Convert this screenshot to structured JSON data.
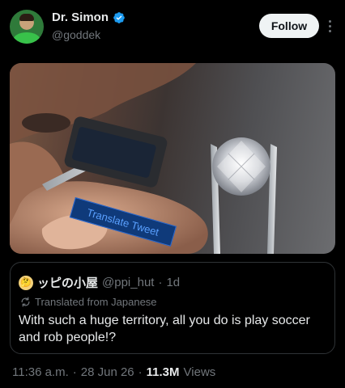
{
  "author": {
    "display_name": "Dr. Simon",
    "handle": "@goddek",
    "verified": true,
    "follow_label": "Follow"
  },
  "media": {
    "overlay_label": "Translate Tweet"
  },
  "quote": {
    "avatar_glyph": "🤔",
    "display_name": "ッピの小屋",
    "handle": "@ppi_hut",
    "separator": "·",
    "time": "1d",
    "translated_label": "Translated from Japanese",
    "text": "With such a huge territory, all you do is play soccer and rob people!?"
  },
  "meta": {
    "time": "11:36 a.m.",
    "sep1": "·",
    "date": "28 Jun 26",
    "sep2": "·",
    "views_count": "11.3M",
    "views_label": "Views"
  },
  "colors": {
    "background": "#000000",
    "text_primary": "#e7e9ea",
    "text_secondary": "#71767b",
    "verified_blue": "#1d9bf0",
    "follow_button_bg": "#eff3f4"
  },
  "icons": [
    "verified-badge-icon",
    "more-options-icon",
    "translate-icon"
  ]
}
